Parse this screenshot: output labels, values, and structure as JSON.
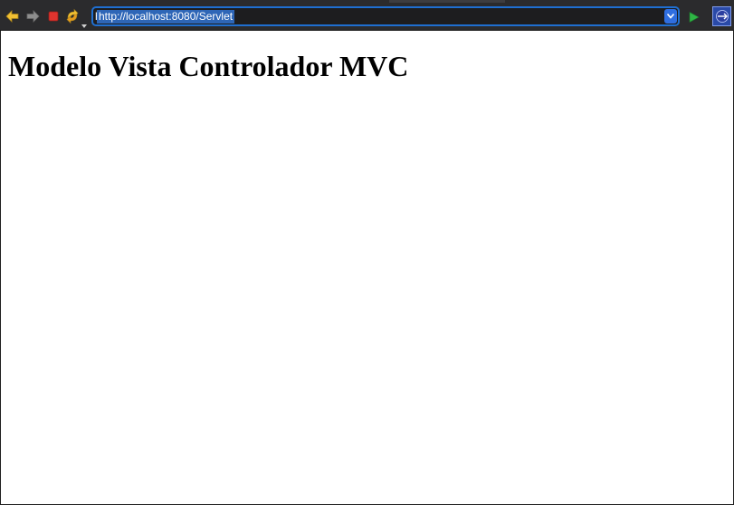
{
  "browser": {
    "url": "http://localhost:8080/Servlet",
    "icons": {
      "back": "back-arrow-icon",
      "forward": "forward-arrow-icon",
      "stop": "stop-icon",
      "refresh": "refresh-icon",
      "dropdown": "chevron-down-icon",
      "go": "play-go-icon",
      "eclipse": "eclipse-external-browser-icon"
    },
    "colors": {
      "toolbar": "#2b2b2d",
      "url_focus": "#1f6fd1",
      "selection": "#2e66b7",
      "stop": "#e0342e",
      "go": "#2fb545"
    }
  },
  "page": {
    "heading": "Modelo Vista Controlador MVC"
  }
}
